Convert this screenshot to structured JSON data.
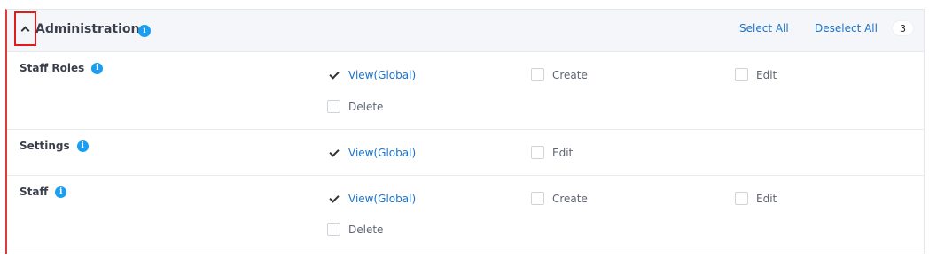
{
  "section": {
    "title": "Administration",
    "select_all": "Select All",
    "deselect_all": "Deselect All",
    "count": "3"
  },
  "rows": [
    {
      "name": "Staff Roles",
      "perms": [
        {
          "label": "View(Global)",
          "checked": true
        },
        {
          "label": "Create",
          "checked": false
        },
        {
          "label": "Edit",
          "checked": false
        },
        {
          "label": "Delete",
          "checked": false
        }
      ]
    },
    {
      "name": "Settings",
      "perms": [
        {
          "label": "View(Global)",
          "checked": true
        },
        {
          "label": "Edit",
          "checked": false
        }
      ]
    },
    {
      "name": "Staff",
      "perms": [
        {
          "label": "View(Global)",
          "checked": true
        },
        {
          "label": "Create",
          "checked": false
        },
        {
          "label": "Edit",
          "checked": false
        },
        {
          "label": "Delete",
          "checked": false
        }
      ]
    }
  ],
  "icons": {
    "collapse": "chevron-up-icon",
    "info": "info-icon",
    "check": "checkmark-icon"
  },
  "colors": {
    "accent": "#1a73c9",
    "info": "#1a9ef0",
    "highlight_border": "#e01c1c",
    "left_bar": "#e03b3b"
  }
}
